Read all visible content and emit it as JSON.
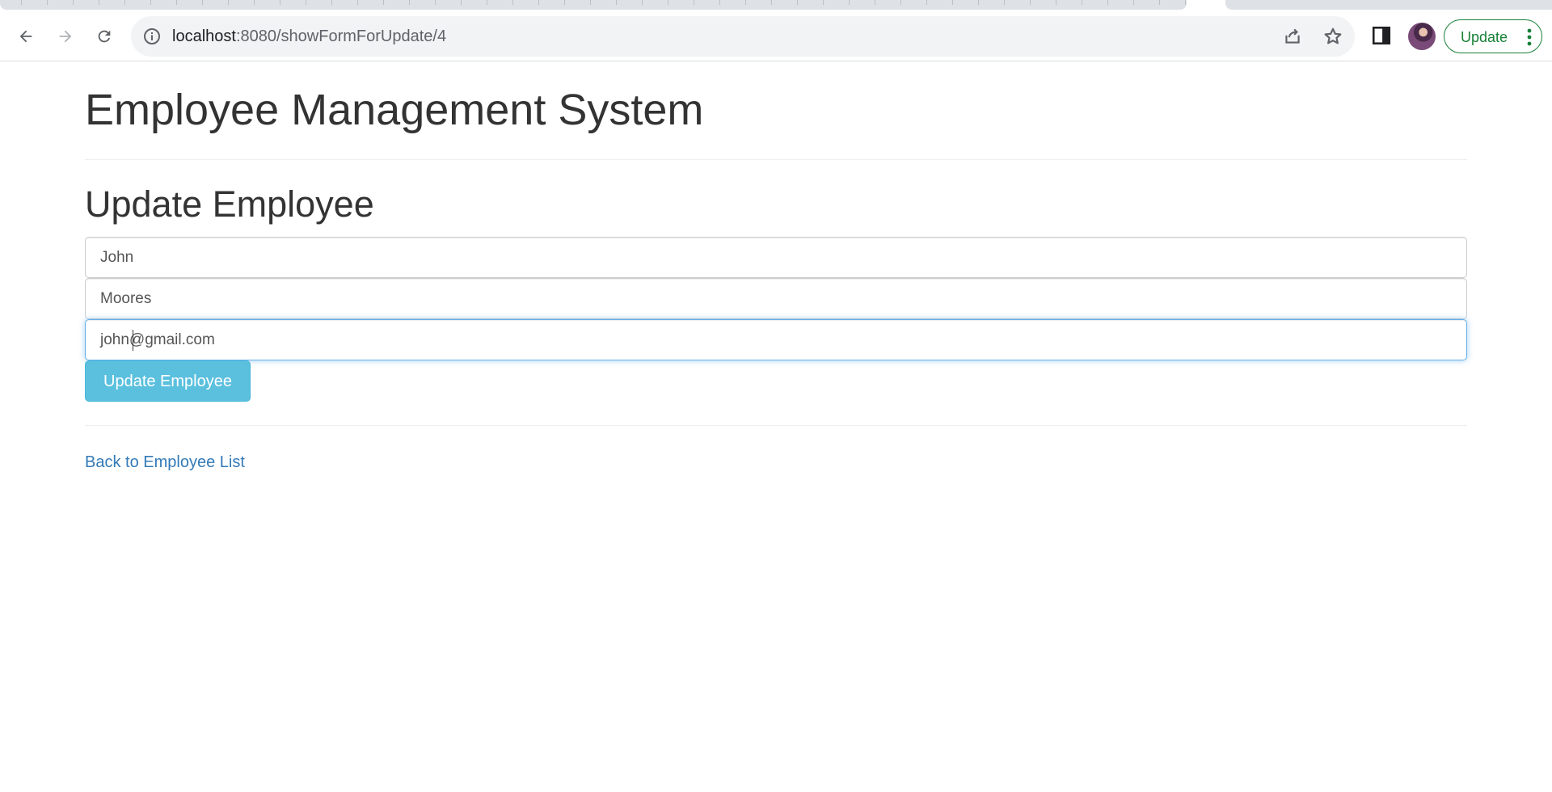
{
  "browser": {
    "url_host": "localhost",
    "url_rest": ":8080/showFormForUpdate/4",
    "update_button_label": "Update",
    "accent_color": "#188038"
  },
  "icons": {
    "back": "back-arrow-icon",
    "forward": "forward-arrow-icon",
    "reload": "reload-icon",
    "site_info": "info-icon",
    "share": "share-icon",
    "bookmark": "star-icon",
    "side_panel": "side-panel-icon",
    "menu": "three-dots-icon"
  },
  "page": {
    "app_title": "Employee Management System",
    "form_title": "Update Employee",
    "fields": {
      "first_name": "John",
      "last_name": "Moores",
      "email": "john@gmail.com"
    },
    "submit_label": "Update Employee",
    "back_link_label": "Back to Employee List"
  },
  "colors": {
    "button_bg": "#5bc0de",
    "link": "#337ab7",
    "focus_border": "#66afe9"
  }
}
